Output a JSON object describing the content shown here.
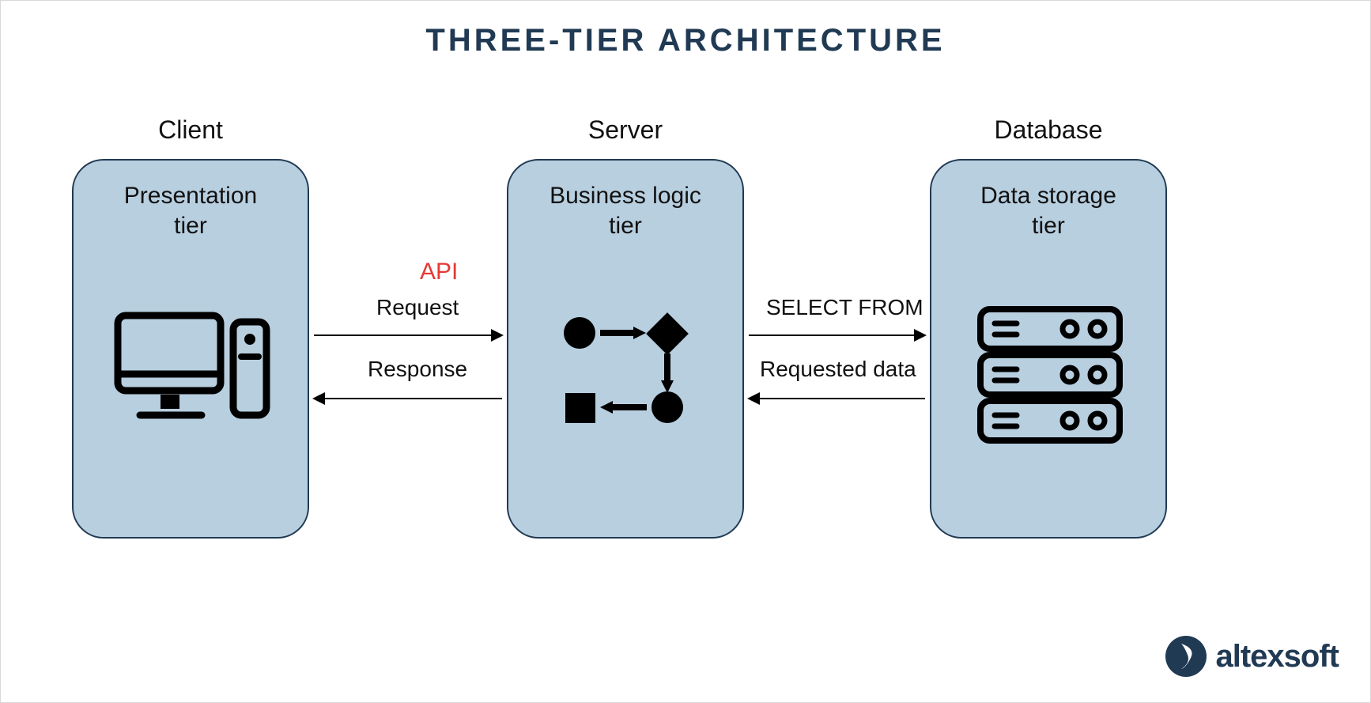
{
  "title": "THREE-TIER ARCHITECTURE",
  "tiers": {
    "client": {
      "header": "Client",
      "subtitle": "Presentation\ntier",
      "icon": "desktop-computer-icon"
    },
    "server": {
      "header": "Server",
      "subtitle": "Business logic\ntier",
      "icon": "flowchart-icon"
    },
    "database": {
      "header": "Database",
      "subtitle": "Data storage\ntier",
      "icon": "server-stack-icon"
    }
  },
  "arrows": {
    "api_label": "API",
    "client_to_server": "Request",
    "server_to_client": "Response",
    "server_to_db": "SELECT FROM",
    "db_to_server": "Requested data"
  },
  "branding": {
    "name": "altexsoft"
  },
  "colors": {
    "title": "#213a54",
    "box_fill": "#b8cfe0",
    "box_border": "#213a54",
    "accent_red": "#e53935"
  }
}
